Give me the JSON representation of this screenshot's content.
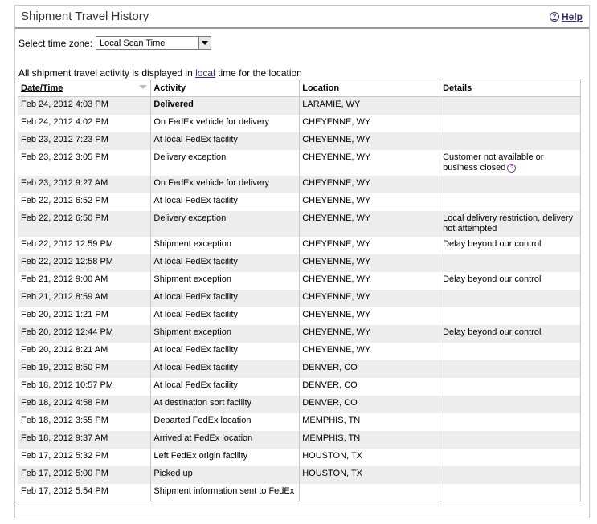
{
  "header": {
    "title": "Shipment Travel History",
    "help_label": "Help",
    "help_glyph": "?"
  },
  "timezone": {
    "label": "Select time zone:",
    "selected": "Local Scan Time"
  },
  "note": {
    "prefix": "All shipment travel activity is displayed in ",
    "link": "local",
    "suffix": " time for the location"
  },
  "columns": {
    "datetime": "Date/Time",
    "activity": "Activity",
    "location": "Location",
    "details": "Details"
  },
  "rows": [
    {
      "datetime": "Feb 24, 2012 4:03 PM",
      "activity": "Delivered",
      "location": "LARAMIE, WY",
      "details": ""
    },
    {
      "datetime": "Feb 24, 2012 4:02 PM",
      "activity": "On FedEx vehicle for delivery",
      "location": "CHEYENNE, WY",
      "details": ""
    },
    {
      "datetime": "Feb 23, 2012 7:23 PM",
      "activity": "At local FedEx facility",
      "location": "CHEYENNE, WY",
      "details": ""
    },
    {
      "datetime": "Feb 23, 2012 3:05 PM",
      "activity": "Delivery exception",
      "location": "CHEYENNE, WY",
      "details": "Customer not available or business closed",
      "help": "?"
    },
    {
      "datetime": "Feb 23, 2012 9:27 AM",
      "activity": "On FedEx vehicle for delivery",
      "location": "CHEYENNE, WY",
      "details": ""
    },
    {
      "datetime": "Feb 22, 2012 6:52 PM",
      "activity": "At local FedEx facility",
      "location": "CHEYENNE, WY",
      "details": ""
    },
    {
      "datetime": "Feb 22, 2012 6:50 PM",
      "activity": "Delivery exception",
      "location": "CHEYENNE, WY",
      "details": "Local delivery restriction, delivery not attempted"
    },
    {
      "datetime": "Feb 22, 2012 12:59 PM",
      "activity": "Shipment exception",
      "location": "CHEYENNE, WY",
      "details": "Delay beyond our control"
    },
    {
      "datetime": "Feb 22, 2012 12:58 PM",
      "activity": "At local FedEx facility",
      "location": "CHEYENNE, WY",
      "details": ""
    },
    {
      "datetime": "Feb 21, 2012 9:00 AM",
      "activity": "Shipment exception",
      "location": "CHEYENNE, WY",
      "details": "Delay beyond our control"
    },
    {
      "datetime": "Feb 21, 2012 8:59 AM",
      "activity": "At local FedEx facility",
      "location": "CHEYENNE, WY",
      "details": ""
    },
    {
      "datetime": "Feb 20, 2012 1:21 PM",
      "activity": "At local FedEx facility",
      "location": "CHEYENNE, WY",
      "details": ""
    },
    {
      "datetime": "Feb 20, 2012 12:44 PM",
      "activity": "Shipment exception",
      "location": "CHEYENNE, WY",
      "details": "Delay beyond our control"
    },
    {
      "datetime": "Feb 20, 2012 8:21 AM",
      "activity": "At local FedEx facility",
      "location": "CHEYENNE, WY",
      "details": ""
    },
    {
      "datetime": "Feb 19, 2012 8:50 PM",
      "activity": "At local FedEx facility",
      "location": "DENVER, CO",
      "details": ""
    },
    {
      "datetime": "Feb 18, 2012 10:57 PM",
      "activity": "At local FedEx facility",
      "location": "DENVER, CO",
      "details": ""
    },
    {
      "datetime": "Feb 18, 2012 4:58 PM",
      "activity": "At destination sort facility",
      "location": "DENVER, CO",
      "details": ""
    },
    {
      "datetime": "Feb 18, 2012 3:55 PM",
      "activity": "Departed FedEx location",
      "location": "MEMPHIS, TN",
      "details": ""
    },
    {
      "datetime": "Feb 18, 2012 9:37 AM",
      "activity": "Arrived at FedEx location",
      "location": "MEMPHIS, TN",
      "details": ""
    },
    {
      "datetime": "Feb 17, 2012 5:32 PM",
      "activity": "Left FedEx origin facility",
      "location": "HOUSTON, TX",
      "details": ""
    },
    {
      "datetime": "Feb 17, 2012 5:00 PM",
      "activity": "Picked up",
      "location": "HOUSTON, TX",
      "details": ""
    },
    {
      "datetime": "Feb 17, 2012 5:54 PM",
      "activity": "Shipment information sent to FedEx",
      "location": "",
      "details": ""
    }
  ],
  "colors": {
    "row_alt": "#ededed",
    "link": "#3b2e75"
  }
}
